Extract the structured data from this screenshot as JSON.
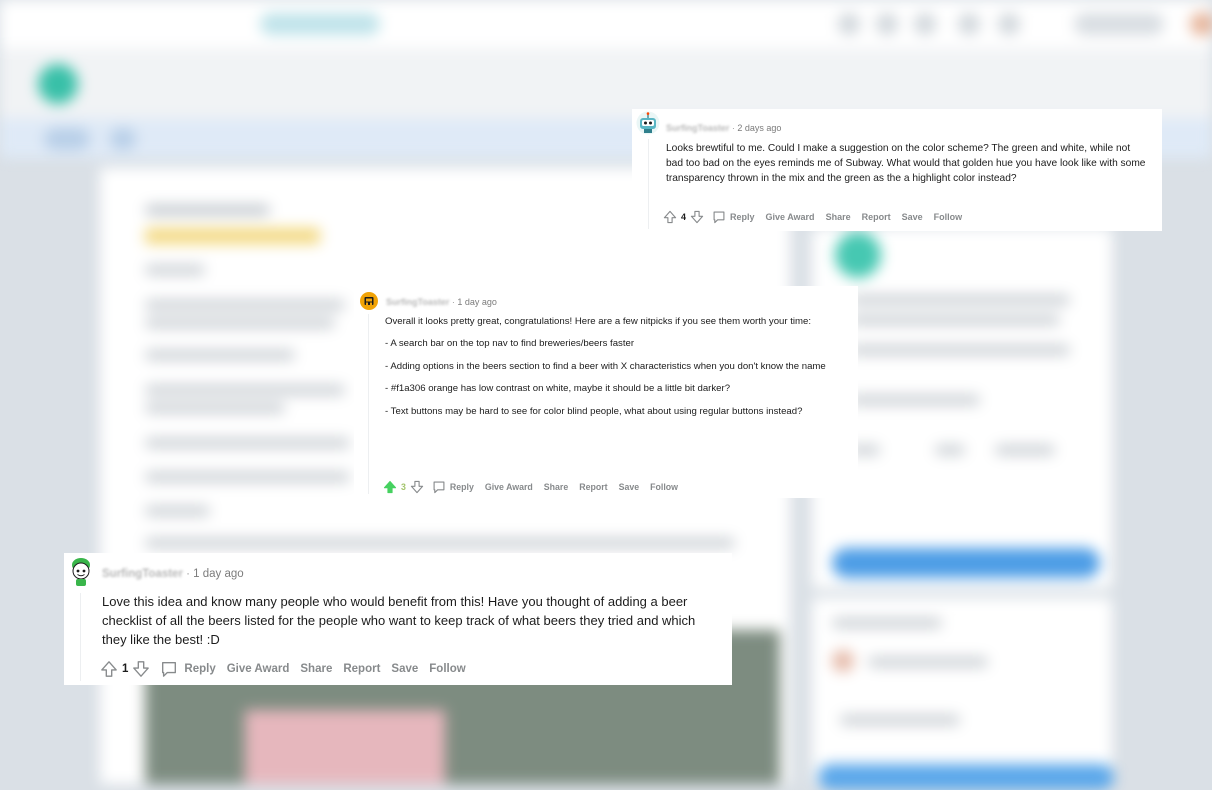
{
  "comments": [
    {
      "username": "SurfingToaster",
      "time_ago": "2 days ago",
      "body": [
        "Looks brewtiful to me. Could I make a suggestion on the color scheme? The green and white, while not bad too bad on the eyes reminds me of Subway. What would that golden hue you have look like with some transparency thrown in the mix and the green as the a highlight color instead?"
      ],
      "votes": "4",
      "actions": [
        "Reply",
        "Give Award",
        "Share",
        "Report",
        "Save",
        "Follow"
      ],
      "avatar_icon": "robot-avatar-icon"
    },
    {
      "username": "SurfingToaster",
      "time_ago": "1 day ago",
      "body": [
        "Overall it looks pretty great, congratulations! Here are a few nitpicks if you see them worth your time:",
        "- A search bar on the top nav to find breweries/beers faster",
        "- Adding options in the beers section to find a beer with X characteristics when you don't know the name",
        "- #f1a306 orange has low contrast on white, maybe it should be a little bit darker?",
        "- Text buttons may be hard to see for color blind people, what about using regular buttons instead?"
      ],
      "votes": "3",
      "actions": [
        "Reply",
        "Give Award",
        "Share",
        "Report",
        "Save",
        "Follow"
      ],
      "avatar_icon": "orange-snoo-avatar-icon"
    },
    {
      "username": "SurfingToaster",
      "time_ago": "1 day ago",
      "body": [
        "Love this idea and know many people who would benefit from this! Have you thought of adding a beer checklist of all the beers listed for the people who want to keep track of what beers they tried and which they like the best! :D"
      ],
      "votes": "1",
      "actions": [
        "Reply",
        "Give Award",
        "Share",
        "Report",
        "Save",
        "Follow"
      ],
      "avatar_icon": "green-hair-snoo-avatar-icon"
    }
  ],
  "colors": {
    "background": "#dae0e6",
    "upvoted": "#46d160",
    "action_text": "#878a8c",
    "orange_avatar": "#f1a306"
  }
}
